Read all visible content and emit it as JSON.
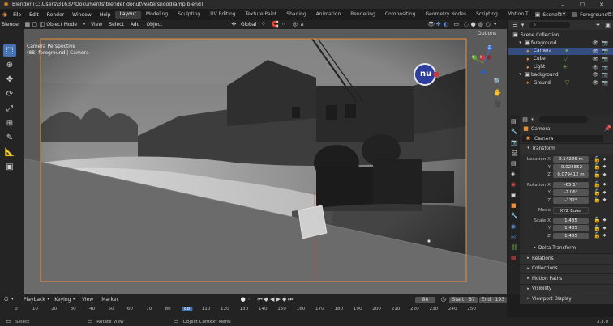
{
  "titlebar": {
    "title": "Blender [C:\\Users\\31637\\Documents\\blender donut\\watersnoodramp.blend]",
    "minimize": "–",
    "maximize": "☐",
    "close": "✕"
  },
  "menubar": {
    "menus": [
      "File",
      "Edit",
      "Render",
      "Window",
      "Help"
    ],
    "workspaces": [
      "Layout",
      "Modeling",
      "Sculpting",
      "UV Editing",
      "Texture Paint",
      "Shading",
      "Animation",
      "Rendering",
      "Compositing",
      "Geometry Nodes",
      "Scripting",
      "Motion T"
    ],
    "active_workspace": "Layout",
    "scene": "Scene",
    "view_layer": "Foreground"
  },
  "viewport_header": {
    "app_label": "Blender",
    "mode": "Object Mode",
    "menus": [
      "View",
      "Select",
      "Add",
      "Object"
    ],
    "transform_orientation": "Global",
    "options": "Options"
  },
  "viewport": {
    "camera_label": "Camera Perspective",
    "camera_sub": "(88) foreground | Camera",
    "logo_text": "nu",
    "gizmo_axes": [
      "X",
      "Y",
      "Z"
    ]
  },
  "outliner": {
    "search_placeholder": "",
    "items": [
      {
        "label": "Scene Collection",
        "indent": 0,
        "selected": false
      },
      {
        "label": "foreground",
        "indent": 1,
        "selected": false
      },
      {
        "label": "Camera",
        "indent": 2,
        "selected": true
      },
      {
        "label": "Cube",
        "indent": 2,
        "selected": false
      },
      {
        "label": "Light",
        "indent": 2,
        "selected": false
      },
      {
        "label": "background",
        "indent": 1,
        "selected": false
      },
      {
        "label": "Ground",
        "indent": 2,
        "selected": false
      }
    ]
  },
  "properties": {
    "object_name": "Camera",
    "data_name": "Camera",
    "transform_header": "Transform",
    "location": {
      "label": "Location X",
      "x": "0.14286 m",
      "y": "-0.022852",
      "z": "0.079412 m"
    },
    "rotation": {
      "label": "Rotation X",
      "x": "-65.1°",
      "y": "-2.06°",
      "z": "-132°"
    },
    "mode_label": "Mode",
    "mode_value": "XYZ Euler",
    "scale": {
      "label": "Scale X",
      "x": "1.435",
      "y": "1.435",
      "z": "1.435"
    },
    "axis_y": "Y",
    "axis_z": "Z",
    "panels": [
      "Delta Transform",
      "Relations",
      "Collections",
      "Motion Paths",
      "Visibility",
      "Viewport Display"
    ]
  },
  "timeline": {
    "menus": [
      "Playback",
      "Keying",
      "View",
      "Marker"
    ],
    "current_frame": "88",
    "start_label": "Start",
    "start": "87",
    "end_label": "End",
    "end": "193",
    "ticks": [
      "0",
      "10",
      "20",
      "30",
      "40",
      "50",
      "60",
      "70",
      "80",
      "88",
      "110",
      "120",
      "130",
      "140",
      "150",
      "160",
      "170",
      "180",
      "190",
      "200",
      "210",
      "220",
      "230",
      "240",
      "250"
    ]
  },
  "statusbar": {
    "select": "Select",
    "rotate": "Rotate View",
    "context": "Object Context Menu",
    "version": "3.3.0"
  },
  "colors": {
    "accent": "#4772b3",
    "selection": "#334d80",
    "orange": "#e8913a",
    "camera_frame": "#e8913a"
  }
}
